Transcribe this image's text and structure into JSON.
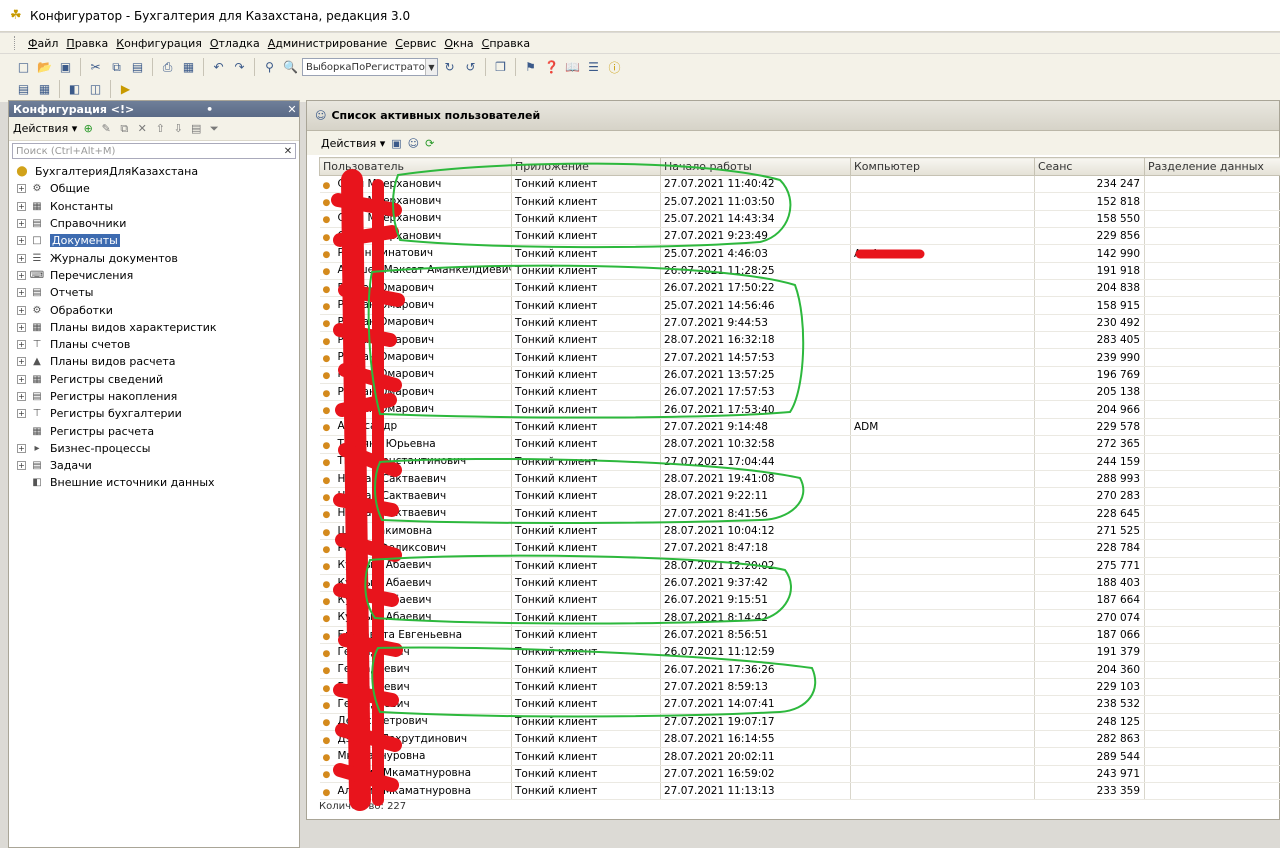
{
  "window": {
    "title": "Конфигуратор - Бухгалтерия для Казахстана, редакция 3.0"
  },
  "menu": [
    "Файл",
    "Правка",
    "Конфигурация",
    "Отладка",
    "Администрирование",
    "Сервис",
    "Окна",
    "Справка"
  ],
  "toolbar": {
    "search_value": "ВыборкаПоРегистрато"
  },
  "config_panel": {
    "title": "Конфигурация <!>",
    "actions_label": "Действия",
    "search_placeholder": "Поиск (Ctrl+Alt+M)",
    "root": "БухгалтерияДляКазахстана",
    "items": [
      {
        "label": "Общие",
        "icon": "general-icon"
      },
      {
        "label": "Константы",
        "icon": "constants-icon"
      },
      {
        "label": "Справочники",
        "icon": "catalogs-icon"
      },
      {
        "label": "Документы",
        "icon": "documents-icon",
        "selected": true
      },
      {
        "label": "Журналы документов",
        "icon": "journals-icon"
      },
      {
        "label": "Перечисления",
        "icon": "enums-icon"
      },
      {
        "label": "Отчеты",
        "icon": "reports-icon"
      },
      {
        "label": "Обработки",
        "icon": "processing-icon"
      },
      {
        "label": "Планы видов характеристик",
        "icon": "chart-of-characteristics-icon"
      },
      {
        "label": "Планы счетов",
        "icon": "chart-of-accounts-icon"
      },
      {
        "label": "Планы видов расчета",
        "icon": "chart-of-calculations-icon"
      },
      {
        "label": "Регистры сведений",
        "icon": "info-registers-icon"
      },
      {
        "label": "Регистры накопления",
        "icon": "accumulation-registers-icon"
      },
      {
        "label": "Регистры бухгалтерии",
        "icon": "accounting-registers-icon"
      },
      {
        "label": "Регистры расчета",
        "icon": "calculation-registers-icon",
        "noexpand": true
      },
      {
        "label": "Бизнес-процессы",
        "icon": "business-processes-icon"
      },
      {
        "label": "Задачи",
        "icon": "tasks-icon"
      },
      {
        "label": "Внешние источники данных",
        "icon": "external-sources-icon",
        "noexpand": true
      }
    ]
  },
  "users_panel": {
    "title": "Список активных пользователей",
    "actions_label": "Действия",
    "columns": [
      "Пользователь",
      "Приложение",
      "Начало работы",
      "Компьютер",
      "Сеанс",
      "Разделение данных"
    ],
    "rows": [
      [
        "Сати Меерханович",
        "Тонкий клиент",
        "27.07.2021 11:40:42",
        "",
        "234 247"
      ],
      [
        "Сати Меерханович",
        "Тонкий клиент",
        "25.07.2021 11:03:50",
        "",
        "152 818"
      ],
      [
        "Сати Меерханович",
        "Тонкий клиент",
        "25.07.2021 14:43:34",
        "",
        "158 550"
      ],
      [
        "Сати Меерханович",
        "Тонкий клиент",
        "27.07.2021 9:23:49",
        "",
        "229 856"
      ],
      [
        "Роман Ринатович",
        "Тонкий клиент",
        "25.07.2021 4:46:03",
        "A…A",
        "142 990"
      ],
      [
        "Абишев Максат Аманкелдиевич",
        "Тонкий клиент",
        "26.07.2021 11:28:25",
        "",
        "191 918"
      ],
      [
        "Руслан Омарович",
        "Тонкий клиент",
        "26.07.2021 17:50:22",
        "",
        "204 838"
      ],
      [
        "Руслан Омарович",
        "Тонкий клиент",
        "25.07.2021 14:56:46",
        "",
        "158 915"
      ],
      [
        "Руслан Омарович",
        "Тонкий клиент",
        "27.07.2021 9:44:53",
        "",
        "230 492"
      ],
      [
        "Руслан Омарович",
        "Тонкий клиент",
        "28.07.2021 16:32:18",
        "",
        "283 405"
      ],
      [
        "Руслан Омарович",
        "Тонкий клиент",
        "27.07.2021 14:57:53",
        "",
        "239 990"
      ],
      [
        "Руслан Омарович",
        "Тонкий клиент",
        "26.07.2021 13:57:25",
        "",
        "196 769"
      ],
      [
        "Руслан Омарович",
        "Тонкий клиент",
        "26.07.2021 17:57:53",
        "",
        "205 138"
      ],
      [
        "Руслан Омарович",
        "Тонкий клиент",
        "26.07.2021 17:53:40",
        "",
        "204 966"
      ],
      [
        "Александр",
        "Тонкий клиент",
        "27.07.2021 9:14:48",
        "ADM",
        "229 578"
      ],
      [
        "Татьяна Юрьевна",
        "Тонкий клиент",
        "28.07.2021 10:32:58",
        "",
        "272 365"
      ],
      [
        "Тимур Константинович",
        "Тонкий клиент",
        "27.07.2021 17:04:44",
        "",
        "244 159"
      ],
      [
        "Нурлан Сактваевич",
        "Тонкий клиент",
        "28.07.2021 19:41:08",
        "",
        "288 993"
      ],
      [
        "Нурлан Сактваевич",
        "Тонкий клиент",
        "28.07.2021 9:22:11",
        "",
        "270 283"
      ],
      [
        "Нурлан Сактваевич",
        "Тонкий клиент",
        "27.07.2021 8:41:56",
        "",
        "228 645"
      ],
      [
        "Шара Хакимовна",
        "Тонкий клиент",
        "28.07.2021 10:04:12",
        "",
        "271 525"
      ],
      [
        "Роберт Феликсович",
        "Тонкий клиент",
        "27.07.2021 8:47:18",
        "",
        "228 784"
      ],
      [
        "Куаныш Абаевич",
        "Тонкий клиент",
        "28.07.2021 12:20:02",
        "",
        "275 771"
      ],
      [
        "Куаныш Абаевич",
        "Тонкий клиент",
        "26.07.2021 9:37:42",
        "",
        "188 403"
      ],
      [
        "Куаныш Абаевич",
        "Тонкий клиент",
        "26.07.2021 9:15:51",
        "",
        "187 664"
      ],
      [
        "Куаныш Абаевич",
        "Тонкий клиент",
        "28.07.2021 8:14:42",
        "",
        "270 074"
      ],
      [
        "Елизавета Евгеньевна",
        "Тонкий клиент",
        "26.07.2021 8:56:51",
        "",
        "187 066"
      ],
      [
        "Геннадьевич",
        "Тонкий клиент",
        "26.07.2021 11:12:59",
        "",
        "191 379"
      ],
      [
        "Геннадьевич",
        "Тонкий клиент",
        "26.07.2021 17:36:26",
        "",
        "204 360"
      ],
      [
        "Геннадьевич",
        "Тонкий клиент",
        "27.07.2021 8:59:13",
        "",
        "229 103"
      ],
      [
        "Геннадьевич",
        "Тонкий клиент",
        "27.07.2021 14:07:41",
        "",
        "238 532"
      ],
      [
        "Денис Петрович",
        "Тонкий клиент",
        "27.07.2021 19:07:17",
        "",
        "248 125"
      ],
      [
        "Дэниэл Пахрутдинович",
        "Тонкий клиент",
        "28.07.2021 16:14:55",
        "",
        "282 863"
      ],
      [
        "Мкаматнуровна",
        "Тонкий клиент",
        "28.07.2021 20:02:11",
        "",
        "289 544"
      ],
      [
        "Альфия Мкаматнуровна",
        "Тонкий клиент",
        "27.07.2021 16:59:02",
        "",
        "243 971"
      ],
      [
        "Альфия Мкаматнуровна",
        "Тонкий клиент",
        "27.07.2021 11:13:13",
        "",
        "233 359"
      ]
    ],
    "count_label": "Количество:",
    "count_value": "227"
  },
  "colors": {
    "selection": "#3d6bb0",
    "panel_header": "#5a6a86",
    "scribble_red": "#e8141c",
    "scribble_green": "#2db83d"
  }
}
